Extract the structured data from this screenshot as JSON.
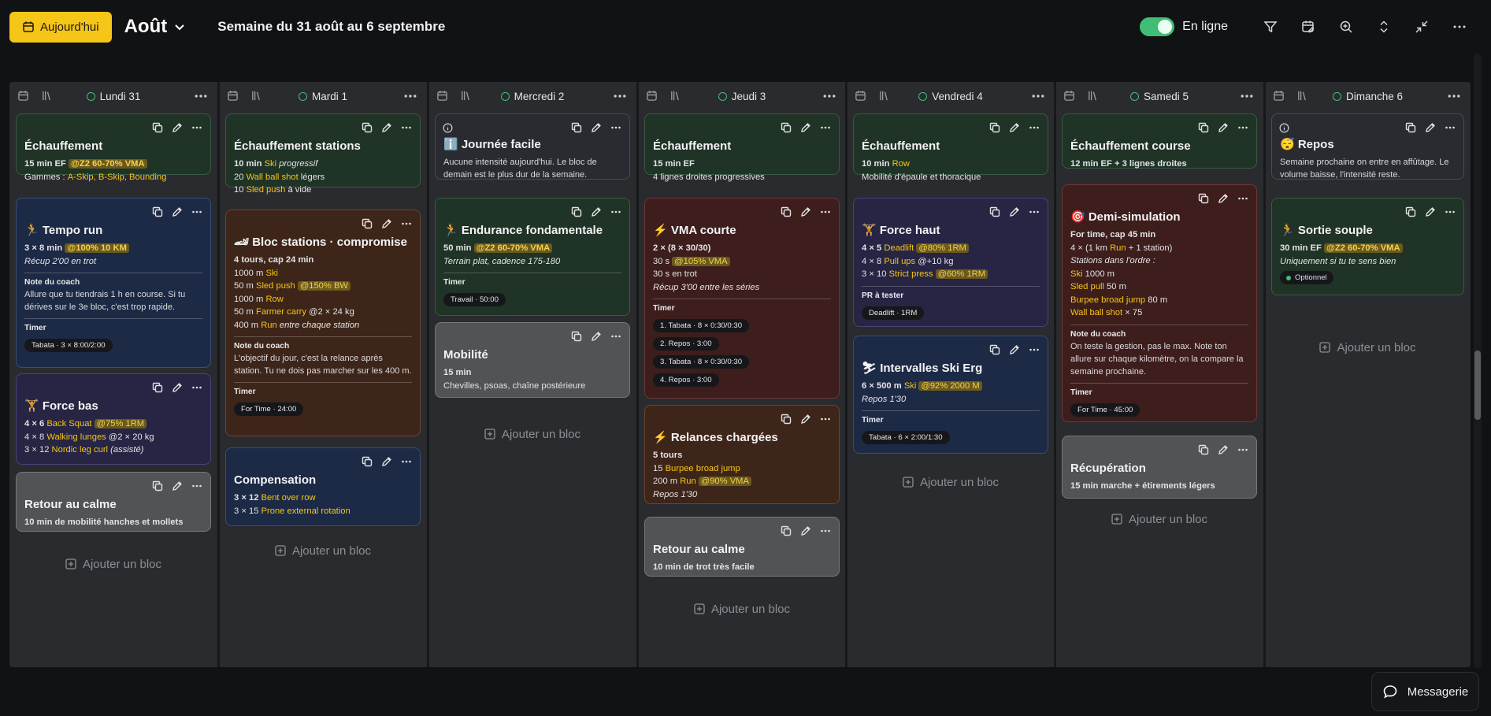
{
  "header": {
    "today_label": "Aujourd'hui",
    "month": "Août",
    "week": "Semaine du 31 août au 6 septembre",
    "online_label": "En ligne"
  },
  "add_block_label": "Ajouter un bloc",
  "messenger_label": "Messagerie",
  "days": [
    {
      "title": "Lundi 31"
    },
    {
      "title": "Mardi 1"
    },
    {
      "title": "Mercredi 2"
    },
    {
      "title": "Jeudi 3"
    },
    {
      "title": "Vendredi 4"
    },
    {
      "title": "Samedi 5"
    },
    {
      "title": "Dimanche 6"
    }
  ],
  "cards": {
    "d0c0": {
      "title": "Échauffement",
      "l1a": "15 min EF",
      "l1b": "@Z2 60-70% VMA",
      "l2a": "Gammes : ",
      "l2b": "A-Skip, B-Skip, Bounding"
    },
    "d0c1": {
      "title": "🏃 Tempo run",
      "l1a": "3 × 8 min",
      "l1b": "@100% 10 KM",
      "l2": "Récup 2'00 en trot",
      "note_h": "Note du coach",
      "note": "Allure que tu tiendrais 1 h en course. Si tu dérives sur le 3e bloc, c'est trop rapide.",
      "timer_h": "Timer",
      "timer": "Tabata · 3 × 8:00/2:00"
    },
    "d0c2": {
      "title": "🏋 Force bas",
      "l1a": "4 × 6",
      "l1b": "Back Squat",
      "l1c": "@75% 1RM",
      "l2a": "4 × 8",
      "l2b": "Walking lunges",
      "l2c": "@2 × 20 kg",
      "l3a": "3 × 12",
      "l3b": "Nordic leg curl",
      "l3c": "(assisté)"
    },
    "d0c3": {
      "title": "Retour au calme",
      "l1": "10 min de mobilité hanches et mollets"
    },
    "d1c0": {
      "title": "Échauffement stations",
      "l1a": "10 min",
      "l1b": "Ski",
      "l1c": "progressif",
      "l2a": "20",
      "l2b": "Wall ball shot",
      "l2c": "légers",
      "l3a": "10",
      "l3b": "Sled push",
      "l3c": "à vide"
    },
    "d1c1": {
      "title": "🏎 Bloc stations · compromise",
      "l1": "4 tours, cap 24 min",
      "l2a": "1000 m",
      "l2b": "Ski",
      "l3a": "50 m",
      "l3b": "Sled push",
      "l3c": "@150% BW",
      "l4a": "1000 m",
      "l4b": "Row",
      "l5a": "50 m",
      "l5b": "Farmer carry",
      "l5c": "@2 × 24 kg",
      "l6a": "400 m",
      "l6b": "Run",
      "l6c": "entre chaque station",
      "note_h": "Note du coach",
      "note": "L'objectif du jour, c'est la relance après station. Tu ne dois pas marcher sur les 400 m.",
      "timer_h": "Timer",
      "timer": "For Time · 24:00"
    },
    "d1c2": {
      "title": "Compensation",
      "l1a": "3 × 12",
      "l1b": "Bent over row",
      "l2a": "3 × 15",
      "l2b": "Prone external rotation"
    },
    "d2c0": {
      "title": "ℹ️ Journée facile",
      "note": "Aucune intensité aujourd'hui. Le bloc de demain est le plus dur de la semaine."
    },
    "d2c1": {
      "title": "🏃 Endurance fondamentale",
      "l1a": "50 min",
      "l1b": "@Z2 60-70% VMA",
      "l2": "Terrain plat, cadence 175-180",
      "timer_h": "Timer",
      "timer": "Travail · 50:00"
    },
    "d2c2": {
      "title": "Mobilité",
      "l1": "15 min",
      "l2": "Chevilles, psoas, chaîne postérieure"
    },
    "d3c0": {
      "title": "Échauffement",
      "l1": "15 min EF",
      "l2": "4 lignes droites progressives"
    },
    "d3c1": {
      "title": "⚡ VMA courte",
      "l1": "2 × (8 × 30/30)",
      "l2a": "30 s",
      "l2b": "@105% VMA",
      "l3": "30 s en trot",
      "l4": "Récup 3'00 entre les séries",
      "timer_h": "Timer",
      "t1": "1. Tabata · 8 × 0:30/0:30",
      "t2": "2. Repos · 3:00",
      "t3": "3. Tabata · 8 × 0:30/0:30",
      "t4": "4. Repos · 3:00"
    },
    "d3c2": {
      "title": "⚡ Relances chargées",
      "l1": "5 tours",
      "l2a": "15",
      "l2b": "Burpee broad jump",
      "l3a": "200 m",
      "l3b": "Run",
      "l3c": "@90% VMA",
      "l4": "Repos 1'30"
    },
    "d3c3": {
      "title": "Retour au calme",
      "l1": "10 min de trot très facile"
    },
    "d4c0": {
      "title": "Échauffement",
      "l1a": "10 min",
      "l1b": "Row",
      "l2": "Mobilité d'épaule et thoracique"
    },
    "d4c1": {
      "title": "🏋 Force haut",
      "l1a": "4 × 5",
      "l1b": "Deadlift",
      "l1c": "@80% 1RM",
      "l2a": "4 × 8",
      "l2b": "Pull ups",
      "l2c": "@+10 kg",
      "l3a": "3 × 10",
      "l3b": "Strict press",
      "l3c": "@60% 1RM",
      "pr_h": "PR à tester",
      "pr": "Deadlift · 1RM"
    },
    "d4c2": {
      "title": "⛷ Intervalles Ski Erg",
      "l1a": "6 × 500 m",
      "l1b": "Ski",
      "l1c": "@92% 2000 M",
      "l2": "Repos 1'30",
      "timer_h": "Timer",
      "timer": "Tabata · 6 × 2:00/1:30"
    },
    "d5c0": {
      "title": "Échauffement course",
      "l1": "12 min EF + 3 lignes droites"
    },
    "d5c1": {
      "title": "🎯 Demi-simulation",
      "l1": "For time, cap 45 min",
      "l2a": "4 × (1 km",
      "l2b": "Run",
      "l2c": "+ 1 station)",
      "l3": "Stations dans l'ordre :",
      "l4a": "Ski",
      "l4b": "1000 m",
      "l5a": "Sled pull",
      "l5b": "50 m",
      "l6a": "Burpee broad jump",
      "l6b": "80 m",
      "l7a": "Wall ball shot",
      "l7b": "× 75",
      "note_h": "Note du coach",
      "note": "On teste la gestion, pas le max. Note ton allure sur chaque kilomètre, on la compare la semaine prochaine.",
      "timer_h": "Timer",
      "timer": "For Time · 45:00"
    },
    "d5c2": {
      "title": "Récupération",
      "l1": "15 min marche + étirements légers"
    },
    "d6c0": {
      "title": "😴 Repos",
      "note": "Semaine prochaine on entre en affûtage. Le volume baisse, l'intensité reste."
    },
    "d6c1": {
      "title": "🏃 Sortie souple",
      "l1a": "30 min EF",
      "l1b": "@Z2 60-70% VMA",
      "l2": "Uniquement si tu te sens bien",
      "pill": "Optionnel"
    }
  }
}
